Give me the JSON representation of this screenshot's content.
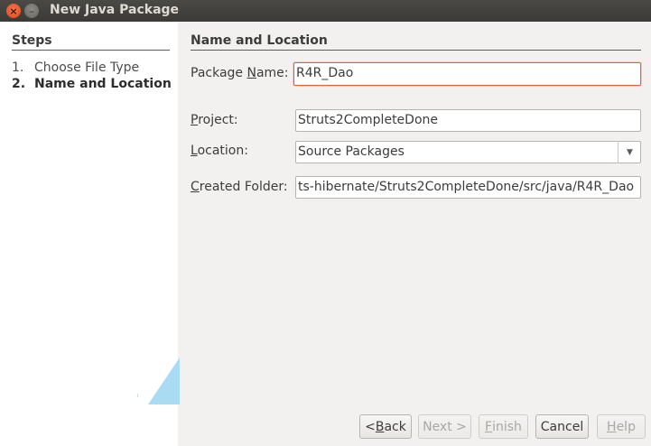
{
  "window": {
    "title": "New Java Package",
    "close_glyph": "×",
    "minimize_glyph": "–"
  },
  "steps": {
    "title": "Steps",
    "items": [
      {
        "number": "1.",
        "label": "Choose File Type"
      },
      {
        "number": "2.",
        "label": "Name and Location"
      }
    ]
  },
  "content": {
    "title": "Name and Location",
    "package_name": {
      "label_pre": "Package ",
      "label_mnemonic": "N",
      "label_post": "ame:",
      "value": "R4R_Dao"
    },
    "project": {
      "label_pre": "",
      "label_mnemonic": "P",
      "label_post": "roject:",
      "value": "Struts2CompleteDone"
    },
    "location": {
      "label_pre": "",
      "label_mnemonic": "L",
      "label_post": "ocation:",
      "value": "Source Packages"
    },
    "created_folder": {
      "label_pre": "",
      "label_mnemonic": "C",
      "label_post": "reated Folder:",
      "value": "ts-hibernate/Struts2CompleteDone/src/java/R4R_Dao"
    }
  },
  "buttons": {
    "back": {
      "pre": "< ",
      "mnemonic": "B",
      "post": "ack"
    },
    "next": {
      "pre": "Next >",
      "mnemonic": "",
      "post": ""
    },
    "finish": {
      "pre": "",
      "mnemonic": "F",
      "post": "inish"
    },
    "cancel": {
      "pre": "Cancel",
      "mnemonic": "",
      "post": ""
    },
    "help": {
      "pre": "",
      "mnemonic": "H",
      "post": "elp"
    }
  },
  "icons": {
    "dropdown": "chevron-down-icon",
    "decoration": "decorative-wedge-icon"
  },
  "colors": {
    "titlebar": "#3c3b37",
    "close_button": "#e9541d",
    "active_field_border": "#e0643a",
    "panel_background": "#ffffff",
    "dialog_background": "#f2f1f0"
  }
}
